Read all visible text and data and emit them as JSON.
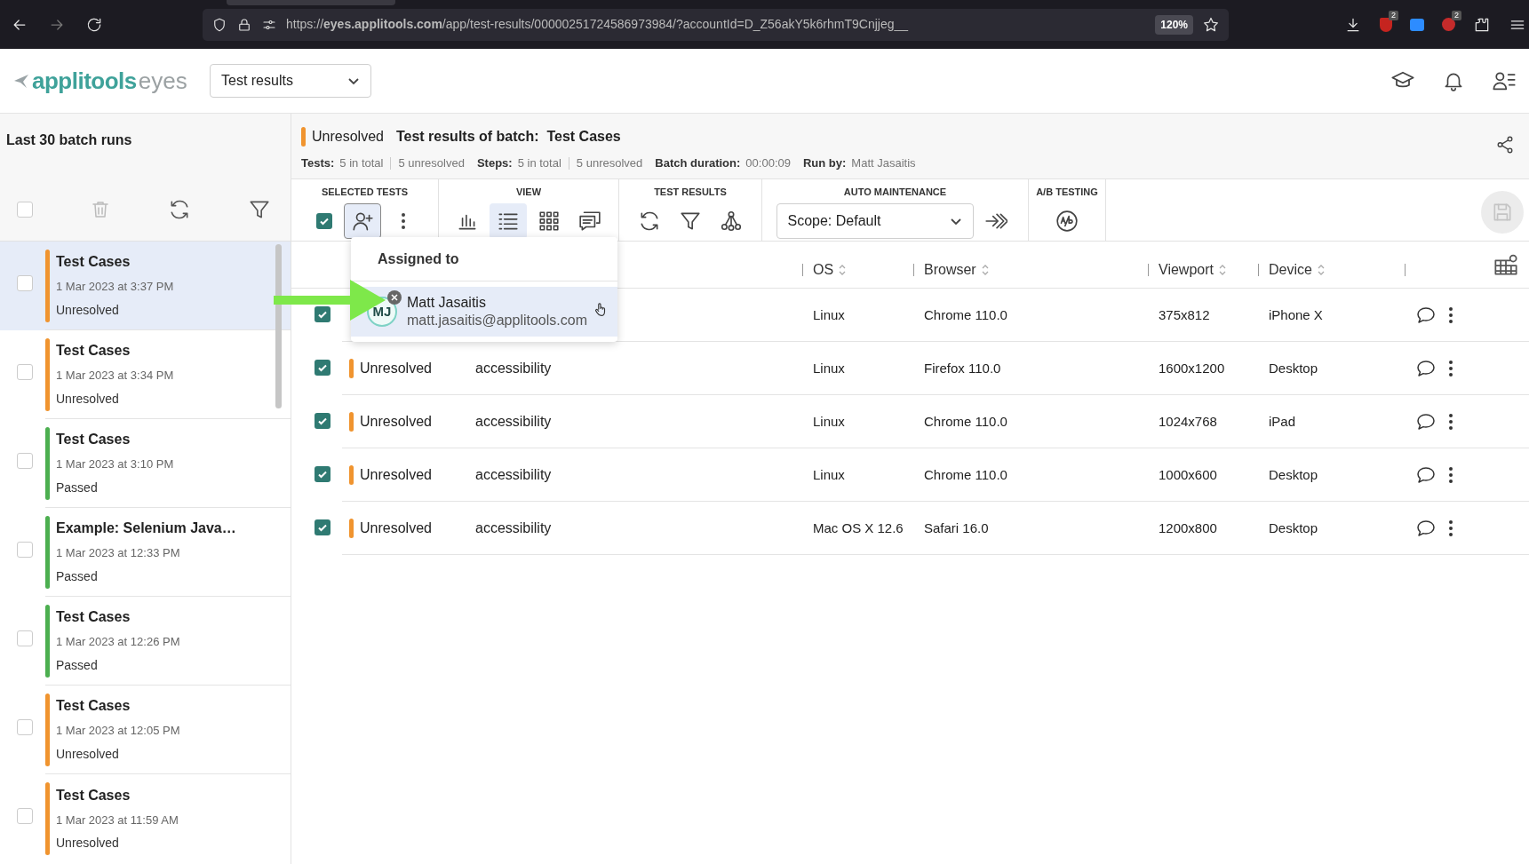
{
  "browser": {
    "url": "https://**eyes.applitools.com**/app/test-results/00000251724586973984/?accountId=D_Z56akY5k6rhmT9Cnjjeg__",
    "zoom": "120%",
    "extensions": [
      {
        "kind": "shield",
        "badge": "2"
      },
      {
        "kind": "camera"
      },
      {
        "kind": "circle",
        "badge": "2"
      }
    ]
  },
  "app": {
    "logo_main": "applitools",
    "logo_sub": "eyes",
    "view_select": "Test results"
  },
  "sidebar": {
    "title": "Last 30 batch runs",
    "select_all_checked": false,
    "batches": [
      {
        "name": "Test Cases",
        "date": "1 Mar 2023 at 3:37 PM",
        "status": "Unresolved",
        "color": "#f0942f",
        "selected": true,
        "checked": false
      },
      {
        "name": "Test Cases",
        "date": "1 Mar 2023 at 3:34 PM",
        "status": "Unresolved",
        "color": "#f0942f",
        "selected": false,
        "checked": false
      },
      {
        "name": "Test Cases",
        "date": "1 Mar 2023 at 3:10 PM",
        "status": "Passed",
        "color": "#4caf50",
        "selected": false,
        "checked": false
      },
      {
        "name": "Example: Selenium Java…",
        "date": "1 Mar 2023 at 12:33 PM",
        "status": "Passed",
        "color": "#4caf50",
        "selected": false,
        "checked": false
      },
      {
        "name": "Test Cases",
        "date": "1 Mar 2023 at 12:26 PM",
        "status": "Passed",
        "color": "#4caf50",
        "selected": false,
        "checked": false
      },
      {
        "name": "Test Cases",
        "date": "1 Mar 2023 at 12:05 PM",
        "status": "Unresolved",
        "color": "#f0942f",
        "selected": false,
        "checked": false
      },
      {
        "name": "Test Cases",
        "date": "1 Mar 2023 at 11:59 AM",
        "status": "Unresolved",
        "color": "#f0942f",
        "selected": false,
        "checked": false
      }
    ]
  },
  "batch": {
    "status": "Unresolved",
    "title": "Test results of batch:  Test Cases",
    "stats": [
      {
        "label": "Tests:",
        "values": [
          "5 in total",
          "5 unresolved"
        ]
      },
      {
        "label": "Steps:",
        "values": [
          "5 in total",
          "5 unresolved"
        ]
      },
      {
        "label": "Batch duration:",
        "values": [
          "00:00:09"
        ]
      },
      {
        "label": "Run by:",
        "values": [
          "Matt Jasaitis"
        ]
      }
    ]
  },
  "toolbar": {
    "groups": [
      {
        "title": "SELECTED TESTS",
        "items": [
          {
            "kind": "checkbox",
            "checked": true
          },
          {
            "kind": "assign",
            "active": true
          },
          {
            "kind": "more",
            "active": false
          }
        ]
      },
      {
        "title": "VIEW",
        "items": [
          {
            "kind": "chart",
            "selected": false
          },
          {
            "kind": "list",
            "selected": true
          },
          {
            "kind": "grid",
            "selected": false
          },
          {
            "kind": "comments",
            "selected": false
          }
        ]
      },
      {
        "title": "TEST RESULTS",
        "items": [
          {
            "kind": "refresh"
          },
          {
            "kind": "filter"
          },
          {
            "kind": "tree"
          }
        ]
      },
      {
        "title": "AUTO MAINTENANCE",
        "items": [
          {
            "kind": "select",
            "value": "Scope: Default"
          },
          {
            "kind": "apply"
          }
        ]
      },
      {
        "title": "A/B TESTING",
        "items": [
          {
            "kind": "ab"
          }
        ]
      }
    ],
    "save_disabled": true
  },
  "assign_popup": {
    "title": "Assigned to",
    "users": [
      {
        "initials": "MJ",
        "name": "Matt Jasaitis",
        "email": "matt.jasaitis@applitools.com",
        "hovered": true
      }
    ]
  },
  "table": {
    "columns": [
      "OS",
      "Browser",
      "Viewport",
      "Device"
    ],
    "rows": [
      {
        "checked": true,
        "os": "Linux",
        "browser": "Chrome 110.0",
        "viewport": "375x812",
        "device": "iPhone X"
      },
      {
        "checked": true,
        "status": "Unresolved",
        "color": "#f0942f",
        "name": "accessibility",
        "os": "Linux",
        "browser": "Firefox 110.0",
        "viewport": "1600x1200",
        "device": "Desktop"
      },
      {
        "checked": true,
        "status": "Unresolved",
        "color": "#f0942f",
        "name": "accessibility",
        "os": "Linux",
        "browser": "Chrome 110.0",
        "viewport": "1024x768",
        "device": "iPad"
      },
      {
        "checked": true,
        "status": "Unresolved",
        "color": "#f0942f",
        "name": "accessibility",
        "os": "Linux",
        "browser": "Chrome 110.0",
        "viewport": "1000x600",
        "device": "Desktop"
      },
      {
        "checked": true,
        "status": "Unresolved",
        "color": "#f0942f",
        "name": "accessibility",
        "os": "Mac OS X 12.6",
        "browser": "Safari 16.0",
        "viewport": "1200x800",
        "device": "Desktop"
      }
    ]
  }
}
